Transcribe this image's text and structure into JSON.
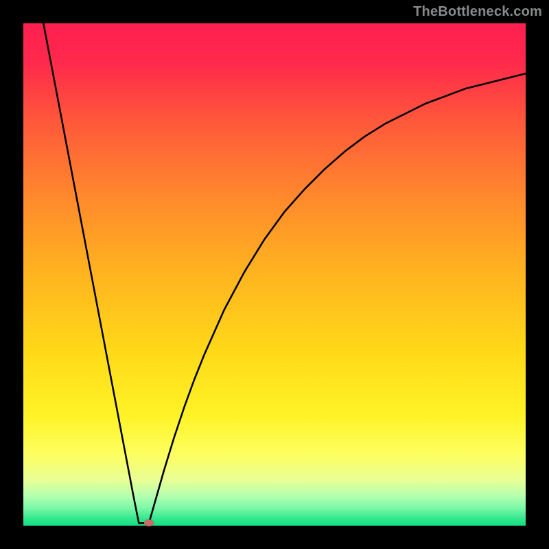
{
  "watermark": {
    "text": "TheBottleneck.com"
  },
  "chart_data": {
    "type": "line",
    "title": "",
    "xlabel": "",
    "ylabel": "",
    "xlim": [
      0,
      100
    ],
    "ylim": [
      0,
      100
    ],
    "grid": false,
    "legend": false,
    "series": [
      {
        "name": "bottleneck-curve",
        "x": [
          4,
          6,
          8,
          10,
          12,
          14,
          16,
          18,
          20,
          22,
          23,
          24,
          25,
          26,
          28,
          30,
          32,
          34,
          36,
          38,
          40,
          44,
          48,
          52,
          56,
          60,
          64,
          68,
          72,
          76,
          80,
          84,
          88,
          92,
          96,
          100
        ],
        "y": [
          100,
          89.5,
          79,
          68.5,
          58,
          47.5,
          37,
          26.5,
          16,
          5.5,
          0.5,
          0.5,
          0.5,
          4,
          11,
          17.5,
          23.5,
          29,
          34,
          38.5,
          43,
          50.5,
          57,
          62.5,
          67,
          71,
          74.5,
          77.5,
          80,
          82,
          84,
          85.5,
          87,
          88,
          89,
          90
        ]
      }
    ],
    "marker": {
      "x": 25,
      "y": 0.5,
      "color": "#cc6b63"
    },
    "background_gradient_stops": [
      {
        "pos": 0.0,
        "color": "#ff1f51"
      },
      {
        "pos": 0.08,
        "color": "#ff2a4b"
      },
      {
        "pos": 0.2,
        "color": "#ff5a3a"
      },
      {
        "pos": 0.35,
        "color": "#ff8a2c"
      },
      {
        "pos": 0.5,
        "color": "#ffb41f"
      },
      {
        "pos": 0.65,
        "color": "#ffd818"
      },
      {
        "pos": 0.78,
        "color": "#fff326"
      },
      {
        "pos": 0.86,
        "color": "#fdff62"
      },
      {
        "pos": 0.91,
        "color": "#e8ff96"
      },
      {
        "pos": 0.94,
        "color": "#b6ffb0"
      },
      {
        "pos": 0.965,
        "color": "#7cf7a8"
      },
      {
        "pos": 0.985,
        "color": "#36e88f"
      },
      {
        "pos": 1.0,
        "color": "#11df82"
      }
    ]
  },
  "layout": {
    "image_size": 800,
    "plot_margin": 34
  }
}
